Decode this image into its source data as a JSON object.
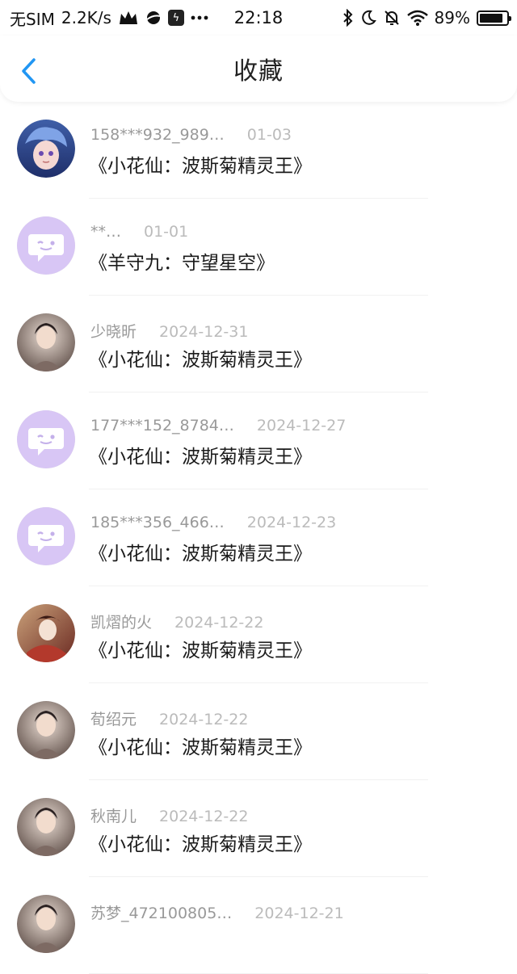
{
  "status_bar": {
    "carrier": "无SIM",
    "speed": "2.2K/s",
    "time": "22:18",
    "battery": "89%",
    "battery_level": 0.89,
    "icons": [
      "crown-icon",
      "planet-icon",
      "bolt-app-icon",
      "more-dots-icon",
      "bluetooth-icon",
      "moon-icon",
      "mute-bell-icon",
      "wifi-icon",
      "battery-icon"
    ]
  },
  "header": {
    "title": "收藏",
    "back_icon": "chevron-left-icon",
    "accent": "#2196f3"
  },
  "favorites": [
    {
      "user": "158***932_989…",
      "date": "01-03",
      "title": "《小花仙：波斯菊精灵王》",
      "avatar": "anime-avatar"
    },
    {
      "user": "**…",
      "date": "01-01",
      "title": "《羊守九：守望星空》",
      "avatar": "default-chat-avatar"
    },
    {
      "user": "少晓昕",
      "date": "2024-12-31",
      "title": "《小花仙：波斯菊精灵王》",
      "avatar": "photo-avatar"
    },
    {
      "user": "177***152_8784…",
      "date": "2024-12-27",
      "title": "《小花仙：波斯菊精灵王》",
      "avatar": "default-chat-avatar"
    },
    {
      "user": "185***356_466…",
      "date": "2024-12-23",
      "title": "《小花仙：波斯菊精灵王》",
      "avatar": "default-chat-avatar"
    },
    {
      "user": "凯熠的火",
      "date": "2024-12-22",
      "title": "《小花仙：波斯菊精灵王》",
      "avatar": "illustration-avatar"
    },
    {
      "user": "荀绍元",
      "date": "2024-12-22",
      "title": "《小花仙：波斯菊精灵王》",
      "avatar": "photo-avatar"
    },
    {
      "user": "秋南儿",
      "date": "2024-12-22",
      "title": "《小花仙：波斯菊精灵王》",
      "avatar": "photo-avatar"
    },
    {
      "user": "苏梦_472100805…",
      "date": "2024-12-21",
      "title": "",
      "avatar": "photo-avatar"
    }
  ]
}
